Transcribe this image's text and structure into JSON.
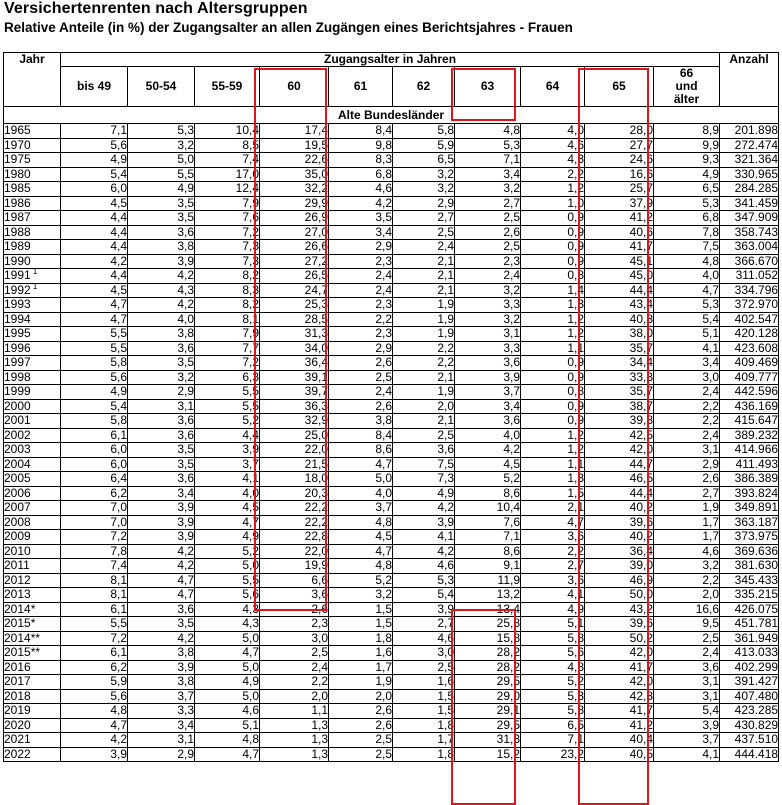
{
  "title": "Versichertenrenten nach Altersgruppen",
  "subtitle": "Relative Anteile (in %) der Zugangsalter an allen Zugängen eines Berichtsjahres - Frauen",
  "header": {
    "year_label": "Jahr",
    "group_label": "Zugangsalter in Jahren",
    "count_label": "Anzahl",
    "age_columns": [
      "bis 49",
      "50-54",
      "55-59",
      "60",
      "61",
      "62",
      "63",
      "64",
      "65",
      "66\nund\nälter"
    ]
  },
  "section_label": "Alte Bundesländer",
  "highlight_color": "#e0151b",
  "rows": [
    {
      "year": "1965",
      "sup": "",
      "v": [
        "7,1",
        "5,3",
        "10,4",
        "17,4",
        "8,4",
        "5,8",
        "4,8",
        "4,0",
        "28,0",
        "8,9"
      ],
      "n": "201.898"
    },
    {
      "year": "1970",
      "sup": "",
      "v": [
        "5,6",
        "3,2",
        "8,5",
        "19,5",
        "9,8",
        "5,9",
        "5,3",
        "4,6",
        "27,7",
        "9,9"
      ],
      "n": "272.474"
    },
    {
      "year": "1975",
      "sup": "",
      "v": [
        "4,9",
        "5,0",
        "7,4",
        "22,6",
        "8,3",
        "6,5",
        "7,1",
        "4,3",
        "24,6",
        "9,3"
      ],
      "n": "321.364"
    },
    {
      "year": "1980",
      "sup": "",
      "v": [
        "5,4",
        "5,5",
        "17,0",
        "35,0",
        "6,8",
        "3,2",
        "3,4",
        "2,2",
        "16,6",
        "4,9"
      ],
      "n": "330.965"
    },
    {
      "year": "1985",
      "sup": "",
      "v": [
        "6,0",
        "4,9",
        "12,4",
        "32,2",
        "4,6",
        "3,2",
        "3,2",
        "1,2",
        "25,7",
        "6,5"
      ],
      "n": "284.285"
    },
    {
      "year": "1986",
      "sup": "",
      "v": [
        "4,5",
        "3,5",
        "7,9",
        "29,9",
        "4,2",
        "2,9",
        "2,7",
        "1,0",
        "37,9",
        "5,3"
      ],
      "n": "341.459"
    },
    {
      "year": "1987",
      "sup": "",
      "v": [
        "4,4",
        "3,5",
        "7,6",
        "26,9",
        "3,5",
        "2,7",
        "2,5",
        "0,9",
        "41,2",
        "6,8"
      ],
      "n": "347.909"
    },
    {
      "year": "1988",
      "sup": "",
      "v": [
        "4,4",
        "3,6",
        "7,2",
        "27,0",
        "3,4",
        "2,5",
        "2,6",
        "0,9",
        "40,6",
        "7,8"
      ],
      "n": "358.743"
    },
    {
      "year": "1989",
      "sup": "",
      "v": [
        "4,4",
        "3,8",
        "7,3",
        "26,6",
        "2,9",
        "2,4",
        "2,5",
        "0,9",
        "41,7",
        "7,5"
      ],
      "n": "363.004"
    },
    {
      "year": "1990",
      "sup": "",
      "v": [
        "4,2",
        "3,9",
        "7,3",
        "27,2",
        "2,3",
        "2,1",
        "2,3",
        "0,9",
        "45,1",
        "4,8"
      ],
      "n": "366.670"
    },
    {
      "year": "1991",
      "sup": "1",
      "v": [
        "4,4",
        "4,2",
        "8,2",
        "26,5",
        "2,4",
        "2,1",
        "2,4",
        "0,8",
        "45,0",
        "4,0"
      ],
      "n": "311.052"
    },
    {
      "year": "1992",
      "sup": "1",
      "v": [
        "4,5",
        "4,3",
        "8,3",
        "24,7",
        "2,4",
        "2,1",
        "3,2",
        "1,4",
        "44,4",
        "4,7"
      ],
      "n": "334.796"
    },
    {
      "year": "1993",
      "sup": "",
      "v": [
        "4,7",
        "4,2",
        "8,2",
        "25,3",
        "2,3",
        "1,9",
        "3,3",
        "1,3",
        "43,4",
        "5,3"
      ],
      "n": "372.970"
    },
    {
      "year": "1994",
      "sup": "",
      "v": [
        "4,7",
        "4,0",
        "8,1",
        "28,5",
        "2,2",
        "1,9",
        "3,2",
        "1,2",
        "40,8",
        "5,4"
      ],
      "n": "402.547"
    },
    {
      "year": "1995",
      "sup": "",
      "v": [
        "5,5",
        "3,8",
        "7,9",
        "31,3",
        "2,3",
        "1,9",
        "3,1",
        "1,2",
        "38,0",
        "5,1"
      ],
      "n": "420.128"
    },
    {
      "year": "1996",
      "sup": "",
      "v": [
        "5,5",
        "3,6",
        "7,7",
        "34,0",
        "2,9",
        "2,2",
        "3,3",
        "1,1",
        "35,7",
        "4,1"
      ],
      "n": "423.608"
    },
    {
      "year": "1997",
      "sup": "",
      "v": [
        "5,8",
        "3,5",
        "7,2",
        "36,4",
        "2,6",
        "2,2",
        "3,6",
        "0,9",
        "34,4",
        "3,4"
      ],
      "n": "409.469"
    },
    {
      "year": "1998",
      "sup": "",
      "v": [
        "5,6",
        "3,2",
        "6,3",
        "39,1",
        "2,5",
        "2,1",
        "3,9",
        "0,9",
        "33,3",
        "3,0"
      ],
      "n": "409.777"
    },
    {
      "year": "1999",
      "sup": "",
      "v": [
        "4,9",
        "2,9",
        "5,5",
        "39,7",
        "2,4",
        "1,9",
        "3,7",
        "0,8",
        "35,7",
        "2,4"
      ],
      "n": "442.596"
    },
    {
      "year": "2000",
      "sup": "",
      "v": [
        "5,4",
        "3,1",
        "5,5",
        "36,3",
        "2,6",
        "2,0",
        "3,4",
        "0,9",
        "38,7",
        "2,2"
      ],
      "n": "436.169"
    },
    {
      "year": "2001",
      "sup": "",
      "v": [
        "5,8",
        "3,6",
        "5,2",
        "32,9",
        "3,8",
        "2,1",
        "3,6",
        "0,9",
        "39,8",
        "2,2"
      ],
      "n": "415.647"
    },
    {
      "year": "2002",
      "sup": "",
      "v": [
        "6,1",
        "3,6",
        "4,4",
        "25,0",
        "8,4",
        "2,5",
        "4,0",
        "1,2",
        "42,5",
        "2,4"
      ],
      "n": "389.232"
    },
    {
      "year": "2003",
      "sup": "",
      "v": [
        "6,0",
        "3,5",
        "3,9",
        "22,0",
        "8,6",
        "3,6",
        "4,2",
        "1,2",
        "42,0",
        "3,1"
      ],
      "n": "414.966"
    },
    {
      "year": "2004",
      "sup": "",
      "v": [
        "6,0",
        "3,5",
        "3,7",
        "21,5",
        "4,7",
        "7,5",
        "4,5",
        "1,1",
        "44,7",
        "2,9"
      ],
      "n": "411.493"
    },
    {
      "year": "2005",
      "sup": "",
      "v": [
        "6,4",
        "3,6",
        "4,1",
        "18,0",
        "5,0",
        "7,3",
        "5,2",
        "1,3",
        "46,5",
        "2,6"
      ],
      "n": "386.389"
    },
    {
      "year": "2006",
      "sup": "",
      "v": [
        "6,2",
        "3,4",
        "4,0",
        "20,3",
        "4,0",
        "4,9",
        "8,6",
        "1,5",
        "44,4",
        "2,7"
      ],
      "n": "393.824"
    },
    {
      "year": "2007",
      "sup": "",
      "v": [
        "7,0",
        "3,9",
        "4,5",
        "22,2",
        "3,7",
        "4,2",
        "10,4",
        "2,1",
        "40,2",
        "1,9"
      ],
      "n": "349.891"
    },
    {
      "year": "2008",
      "sup": "",
      "v": [
        "7,0",
        "3,9",
        "4,7",
        "22,2",
        "4,8",
        "3,9",
        "7,6",
        "4,7",
        "39,6",
        "1,7"
      ],
      "n": "363.187"
    },
    {
      "year": "2009",
      "sup": "",
      "v": [
        "7,2",
        "3,9",
        "4,9",
        "22,8",
        "4,5",
        "4,1",
        "7,1",
        "3,6",
        "40,2",
        "1,7"
      ],
      "n": "373.975"
    },
    {
      "year": "2010",
      "sup": "",
      "v": [
        "7,8",
        "4,2",
        "5,2",
        "22,0",
        "4,7",
        "4,2",
        "8,6",
        "2,2",
        "36,4",
        "4,6"
      ],
      "n": "369.636"
    },
    {
      "year": "2011",
      "sup": "",
      "v": [
        "7,4",
        "4,2",
        "5,0",
        "19,9",
        "4,8",
        "4,6",
        "9,1",
        "2,7",
        "39,0",
        "3,2"
      ],
      "n": "381.630"
    },
    {
      "year": "2012",
      "sup": "",
      "v": [
        "8,1",
        "4,7",
        "5,5",
        "6,6",
        "5,2",
        "5,3",
        "11,9",
        "3,6",
        "46,9",
        "2,2"
      ],
      "n": "345.433"
    },
    {
      "year": "2013",
      "sup": "",
      "v": [
        "8,1",
        "4,7",
        "5,6",
        "3,6",
        "3,2",
        "5,4",
        "13,2",
        "4,1",
        "50,0",
        "2,0"
      ],
      "n": "335.215"
    },
    {
      "year": "2014*",
      "sup": "",
      "v": [
        "6,1",
        "3,6",
        "4,3",
        "2,6",
        "1,5",
        "3,9",
        "13,4",
        "4,9",
        "43,2",
        "16,6"
      ],
      "n": "426.075"
    },
    {
      "year": "2015*",
      "sup": "",
      "v": [
        "5,5",
        "3,5",
        "4,3",
        "2,3",
        "1,5",
        "2,7",
        "25,8",
        "5,1",
        "39,6",
        "9,5"
      ],
      "n": "451.781"
    },
    {
      "year": "2014**",
      "sup": "",
      "v": [
        "7,2",
        "4,2",
        "5,0",
        "3,0",
        "1,8",
        "4,6",
        "15,8",
        "5,8",
        "50,2",
        "2,5"
      ],
      "n": "361.949"
    },
    {
      "year": "2015**",
      "sup": "",
      "v": [
        "6,1",
        "3,8",
        "4,7",
        "2,5",
        "1,6",
        "3,0",
        "28,2",
        "5,6",
        "42,0",
        "2,4"
      ],
      "n": "413.033"
    },
    {
      "year": "2016",
      "sup": "",
      "v": [
        "6,2",
        "3,9",
        "5,0",
        "2,4",
        "1,7",
        "2,5",
        "28,2",
        "4,8",
        "41,7",
        "3,6"
      ],
      "n": "402.299"
    },
    {
      "year": "2017",
      "sup": "",
      "v": [
        "5,9",
        "3,8",
        "4,9",
        "2,2",
        "1,9",
        "1,6",
        "29,5",
        "5,2",
        "42,0",
        "3,1"
      ],
      "n": "391.427"
    },
    {
      "year": "2018",
      "sup": "",
      "v": [
        "5,6",
        "3,7",
        "5,0",
        "2,0",
        "2,0",
        "1,5",
        "29,0",
        "5,3",
        "42,8",
        "3,1"
      ],
      "n": "407.480"
    },
    {
      "year": "2019",
      "sup": "",
      "v": [
        "4,8",
        "3,3",
        "4,6",
        "1,1",
        "2,6",
        "1,5",
        "29,1",
        "5,8",
        "41,7",
        "5,4"
      ],
      "n": "423.285"
    },
    {
      "year": "2020",
      "sup": "",
      "v": [
        "4,7",
        "3,4",
        "5,1",
        "1,3",
        "2,6",
        "1,8",
        "29,5",
        "6,5",
        "41,2",
        "3,9"
      ],
      "n": "430.829"
    },
    {
      "year": "2021",
      "sup": "",
      "v": [
        "4,2",
        "3,1",
        "4,8",
        "1,3",
        "2,5",
        "1,7",
        "31,3",
        "7,1",
        "40,4",
        "3,7"
      ],
      "n": "437.510"
    },
    {
      "year": "2022",
      "sup": "",
      "v": [
        "3,9",
        "2,9",
        "4,7",
        "1,3",
        "2,5",
        "1,8",
        "15,2",
        "23,2",
        "40,5",
        "4,1"
      ],
      "n": "444.418"
    }
  ]
}
